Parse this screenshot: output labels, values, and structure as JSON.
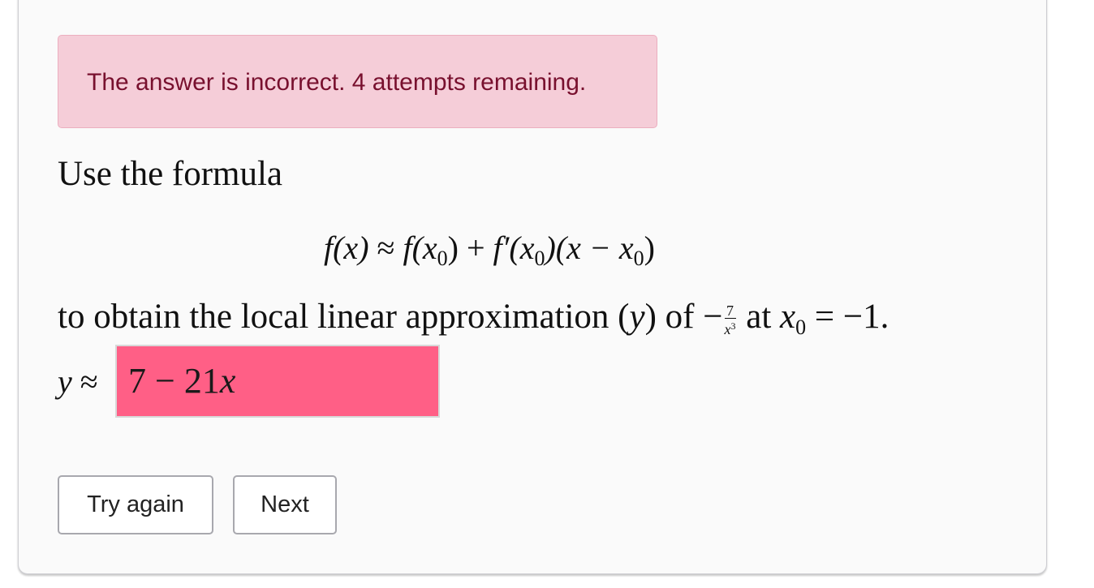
{
  "alert": {
    "message": "The answer is incorrect. 4 attempts remaining."
  },
  "question": {
    "intro": "Use the formula",
    "formula": {
      "lhs": "f(x)",
      "approx": "≈",
      "rhs_term1": "f(x",
      "rhs_sub1": "0",
      "rhs_term1_close": ")",
      "plus": "+",
      "rhs_term2": "f′(x",
      "rhs_sub2": "0",
      "rhs_term2_close": ")(x −",
      "rhs_term3": "x",
      "rhs_sub3": "0",
      "rhs_term3_close": ")"
    },
    "line2": {
      "text_before": "to obtain the local linear approximation (",
      "var": "y",
      "text_mid": ") of −",
      "frac_num": "7",
      "frac_den": "x",
      "frac_den_exp": "3",
      "text_at": " at ",
      "x0": "x",
      "x0_sub": "0",
      "text_end": " = −1."
    }
  },
  "answer": {
    "label_var": "y",
    "label_approx": " ≈",
    "value_num": "7 − 21",
    "value_var": "x",
    "status_color": "#ff5f86"
  },
  "buttons": {
    "try_again": "Try again",
    "next": "Next"
  }
}
